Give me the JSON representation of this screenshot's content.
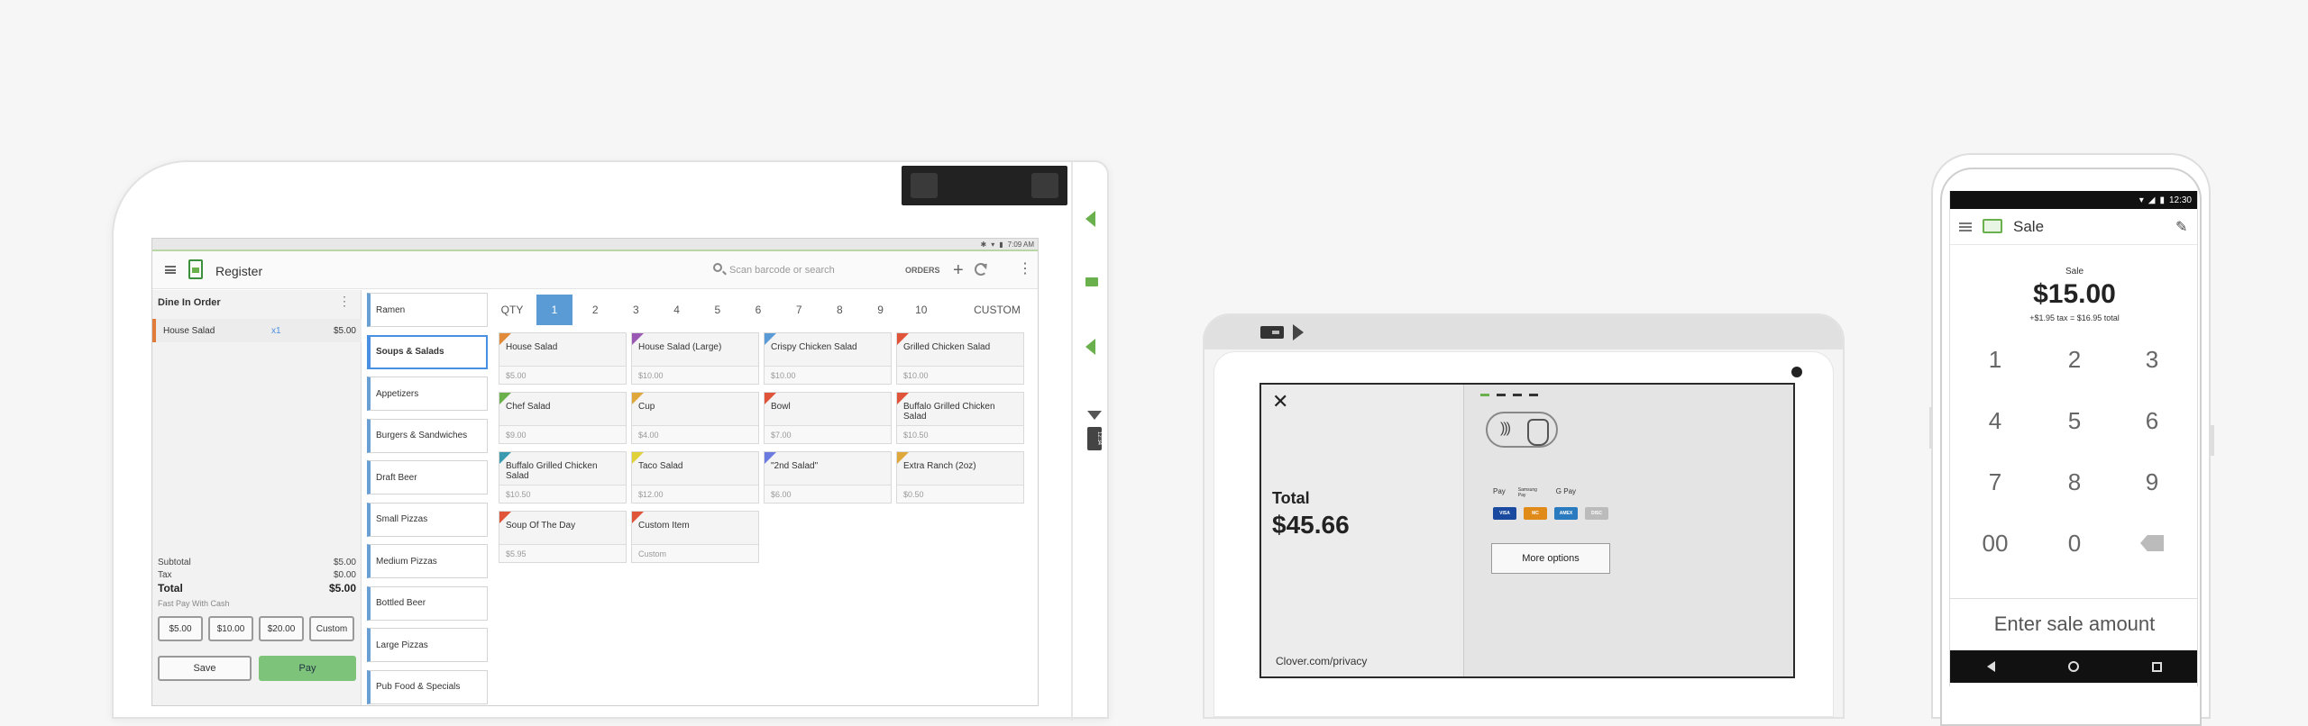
{
  "tablet": {
    "status_time": "7:09 AM",
    "app_title": "Register",
    "search_placeholder": "Scan barcode or search",
    "orders_label": "ORDERS",
    "side_tag": "12:34",
    "order": {
      "title": "Dine In Order",
      "line": {
        "name": "House Salad",
        "qty": "x1",
        "price": "$5.00"
      },
      "subtotal_label": "Subtotal",
      "subtotal": "$5.00",
      "tax_label": "Tax",
      "tax": "$0.00",
      "total_label": "Total",
      "total": "$5.00",
      "fast_pay_label": "Fast Pay With Cash",
      "cash_buttons": [
        "$5.00",
        "$10.00",
        "$20.00",
        "Custom"
      ],
      "save_label": "Save",
      "pay_label": "Pay"
    },
    "categories": [
      "Ramen",
      "Soups & Salads",
      "Appetizers",
      "Burgers & Sandwiches",
      "Draft Beer",
      "Small Pizzas",
      "Medium Pizzas",
      "Bottled Beer",
      "Large Pizzas",
      "Pub Food & Specials"
    ],
    "active_category": "Soups & Salads",
    "qty_label": "QTY",
    "qty_values": [
      "1",
      "2",
      "3",
      "4",
      "5",
      "6",
      "7",
      "8",
      "9",
      "10"
    ],
    "qty_custom": "CUSTOM",
    "items": [
      {
        "name": "House Salad",
        "price": "$5.00",
        "color": "#e08a3a"
      },
      {
        "name": "House Salad (Large)",
        "price": "$10.00",
        "color": "#9b59b6"
      },
      {
        "name": "Crispy Chicken Salad",
        "price": "$10.00",
        "color": "#5b9bd5"
      },
      {
        "name": "Grilled Chicken Salad",
        "price": "$10.00",
        "color": "#e0553a"
      },
      {
        "name": "Chef Salad",
        "price": "$9.00",
        "color": "#6ab04c"
      },
      {
        "name": "Cup",
        "price": "$4.00",
        "color": "#e0a83a"
      },
      {
        "name": "Bowl",
        "price": "$7.00",
        "color": "#e0553a"
      },
      {
        "name": "Buffalo Grilled Chicken Salad",
        "price": "$10.50",
        "color": "#e0553a"
      },
      {
        "name": "Buffalo Grilled Chicken Salad",
        "price": "$10.50",
        "color": "#3a9ab0"
      },
      {
        "name": "Taco Salad",
        "price": "$12.00",
        "color": "#e0d03a"
      },
      {
        "name": "\"2nd Salad\"",
        "price": "$6.00",
        "color": "#6c7be0"
      },
      {
        "name": "Extra Ranch (2oz)",
        "price": "$0.50",
        "color": "#e0a83a"
      },
      {
        "name": "Soup Of The Day",
        "price": "$5.95",
        "color": "#e0553a"
      },
      {
        "name": "Custom Item",
        "price": "Custom",
        "color": "#e0553a"
      }
    ]
  },
  "reader": {
    "total_label": "Total",
    "total": "$45.66",
    "privacy": "Clover.com/privacy",
    "wallets": [
      "Pay",
      "Samsung Pay",
      "G Pay"
    ],
    "cards": [
      {
        "name": "VISA",
        "color": "#1a4aa0"
      },
      {
        "name": "MC",
        "color": "#e08a1a"
      },
      {
        "name": "AMEX",
        "color": "#2a7ac0"
      },
      {
        "name": "DISC",
        "color": "#bbbbbb"
      }
    ],
    "more_options": "More options"
  },
  "phone": {
    "status_time": "12:30",
    "title": "Sale",
    "sale_label": "Sale",
    "amount": "$15.00",
    "tax_line": "+$1.95 tax = $16.95 total",
    "keys": [
      "1",
      "2",
      "3",
      "4",
      "5",
      "6",
      "7",
      "8",
      "9",
      "00",
      "0"
    ],
    "enter_label": "Enter sale amount"
  }
}
